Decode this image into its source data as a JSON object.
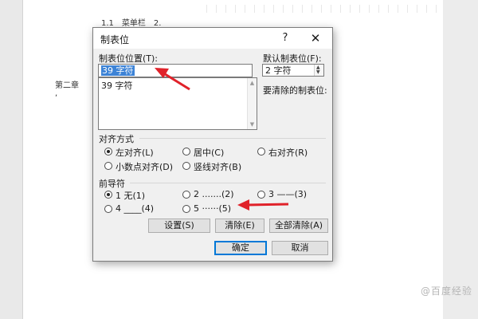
{
  "document": {
    "heading": "1.1　菜单栏　2.",
    "chapter": "第二章　",
    "mark": ","
  },
  "dialog": {
    "title": "制表位",
    "help": "?",
    "close": "✕",
    "tab_position_label": "制表位位置(T):",
    "tab_position_value": "39 字符",
    "tab_list": [
      "39 字符"
    ],
    "default_tab_label": "默认制表位(F):",
    "default_tab_value": "2 字符",
    "clear_label": "要清除的制表位:",
    "alignment": {
      "title": "对齐方式",
      "options": [
        "左对齐(L)",
        "居中(C)",
        "右对齐(R)",
        "小数点对齐(D)",
        "竖线对齐(B)"
      ],
      "selected": "左对齐(L)"
    },
    "leader": {
      "title": "前导符",
      "options": [
        "1 无(1)",
        "2 .......(2)",
        "3 ——(3)",
        "4 ____(4)",
        "5 ······(5)"
      ],
      "selected": "1 无(1)"
    },
    "buttons": {
      "set": "设置(S)",
      "clear": "清除(E)",
      "clear_all": "全部清除(A)",
      "ok": "确定",
      "cancel": "取消"
    }
  },
  "watermark": "@百度经验",
  "colors": {
    "selection": "#3d83d6",
    "annotation_arrow": "#e0222a",
    "default_button_border": "#0078d7"
  }
}
